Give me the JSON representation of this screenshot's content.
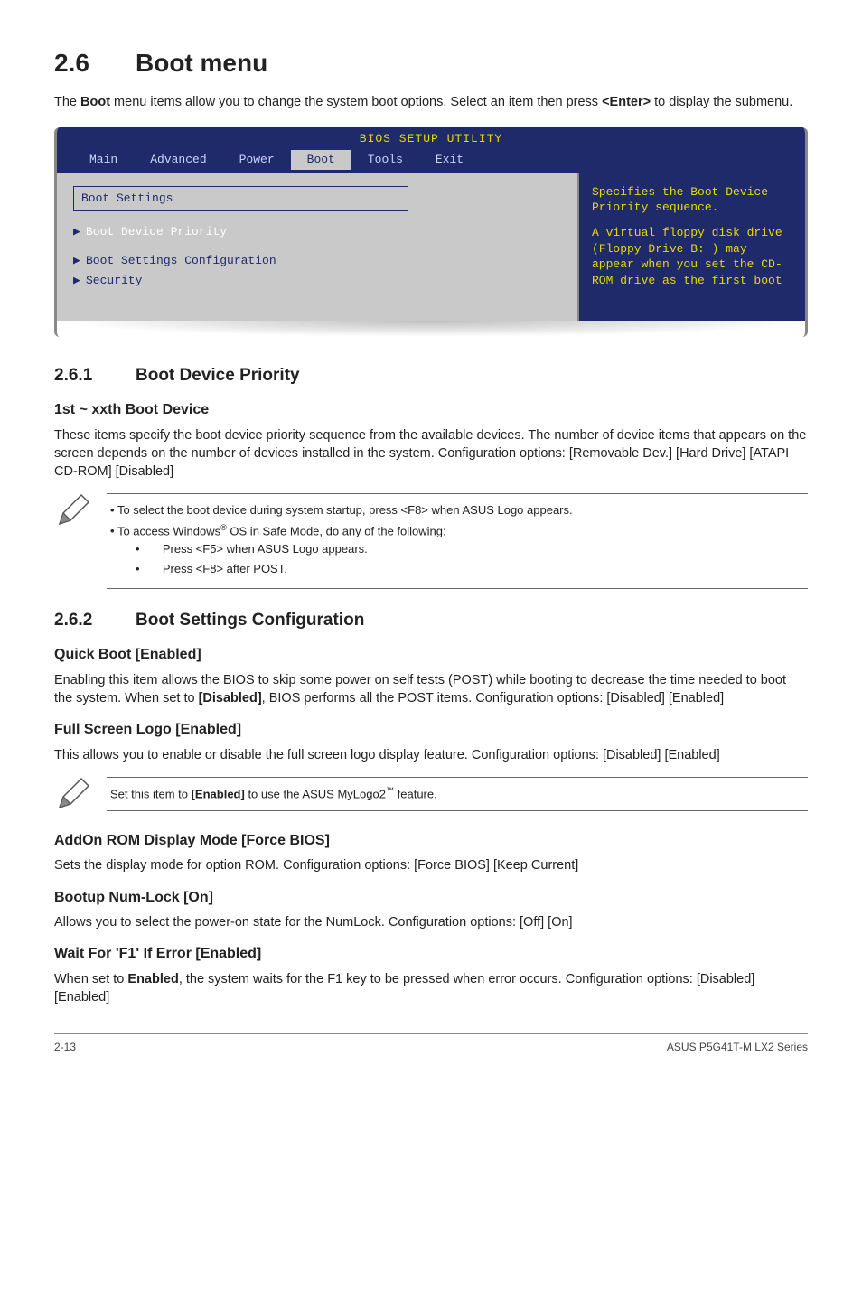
{
  "section": {
    "number": "2.6",
    "title": "Boot menu",
    "intro_pre": "The ",
    "intro_bold1": "Boot",
    "intro_mid": " menu items allow you to change the system boot options. Select an item then press ",
    "intro_bold2": "<Enter>",
    "intro_post": " to display the submenu."
  },
  "bios": {
    "setup_title": "BIOS SETUP UTILITY",
    "tabs": {
      "main": "Main",
      "advanced": "Advanced",
      "power": "Power",
      "boot": "Boot",
      "tools": "Tools",
      "exit": "Exit"
    },
    "left": {
      "heading": "Boot Settings",
      "row1": "Boot Device Priority",
      "row2": "Boot Settings Configuration",
      "row3": "Security"
    },
    "right": {
      "line1": "Specifies the Boot Device Priority sequence.",
      "spacer": "",
      "line2": "A virtual floppy disk drive (Floppy Drive B: ) may appear when you set the CD-ROM drive as the first boot"
    }
  },
  "s261": {
    "number": "2.6.1",
    "title": "Boot Device Priority",
    "h3": "1st ~ xxth Boot Device",
    "p": "These items specify the boot device priority sequence from the available devices. The number of device items that appears on the screen depends on the number of devices installed in the system. Configuration options: [Removable Dev.] [Hard Drive] [ATAPI CD-ROM] [Disabled]"
  },
  "note1": {
    "li1": "To select the boot device during system startup, press <F8> when ASUS Logo appears.",
    "li2_pre": "To access Windows",
    "li2_sup": "®",
    "li2_post": " OS in Safe Mode, do any of the following:",
    "li2a": "Press <F5> when ASUS Logo appears.",
    "li2b": "Press <F8> after POST."
  },
  "s262": {
    "number": "2.6.2",
    "title": "Boot Settings Configuration",
    "qb_h": "Quick Boot [Enabled]",
    "qb_p_pre": "Enabling this item allows the BIOS to skip some power on self tests (POST) while booting to decrease the time needed to boot the system. When set to ",
    "qb_p_bold": "[Disabled]",
    "qb_p_post": ", BIOS performs all the POST items. Configuration options: [Disabled] [Enabled]",
    "fs_h": "Full Screen Logo [Enabled]",
    "fs_p": "This allows you to enable or disable the full screen logo display feature. Configuration options: [Disabled] [Enabled]"
  },
  "note2": {
    "text_pre": "Set this item to ",
    "text_bold": "[Enabled]",
    "text_mid": " to use the ASUS MyLogo2",
    "text_sup": "™",
    "text_post": " feature."
  },
  "addon": {
    "h": "AddOn ROM Display Mode [Force BIOS]",
    "p": "Sets the display mode for option ROM. Configuration options: [Force BIOS] [Keep Current]"
  },
  "numlock": {
    "h": "Bootup Num-Lock [On]",
    "p": "Allows you to select the power-on state for the NumLock. Configuration options: [Off] [On]"
  },
  "waitf1": {
    "h": "Wait For 'F1' If Error [Enabled]",
    "p_pre": "When set to ",
    "p_bold": "Enabled",
    "p_post": ", the system waits for the F1 key to be pressed when error occurs. Configuration options: [Disabled] [Enabled]"
  },
  "footer": {
    "left": "2-13",
    "right": "ASUS P5G41T-M LX2 Series"
  }
}
